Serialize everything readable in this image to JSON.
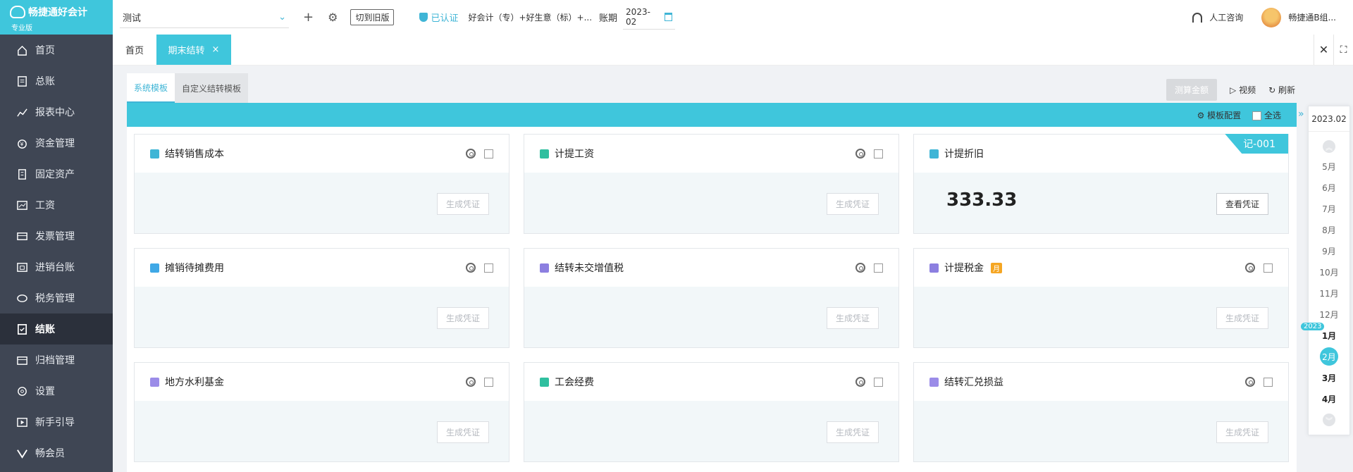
{
  "app": {
    "brand": "畅捷通好会计",
    "edition": "专业版"
  },
  "sidebar": {
    "items": [
      {
        "label": "首页",
        "icon": "home-icon"
      },
      {
        "label": "总账",
        "icon": "ledger-icon"
      },
      {
        "label": "报表中心",
        "icon": "chart-icon"
      },
      {
        "label": "资金管理",
        "icon": "money-bag-icon"
      },
      {
        "label": "固定资产",
        "icon": "building-icon"
      },
      {
        "label": "工资",
        "icon": "salary-icon"
      },
      {
        "label": "发票管理",
        "icon": "invoice-icon"
      },
      {
        "label": "进销台账",
        "icon": "inventory-icon"
      },
      {
        "label": "税务管理",
        "icon": "tax-icon"
      },
      {
        "label": "结账",
        "icon": "closing-icon",
        "active": true
      },
      {
        "label": "归档管理",
        "icon": "archive-icon"
      },
      {
        "label": "设置",
        "icon": "gear-icon"
      },
      {
        "label": "新手引导",
        "icon": "guide-icon"
      },
      {
        "label": "畅会员",
        "icon": "vip-icon"
      }
    ]
  },
  "topbar": {
    "account": "测试",
    "old_version": "切到旧版",
    "verified": "已认证",
    "company": "好会计（专）+好生意（标）+...",
    "period_label": "账期",
    "period_value": "2023-02",
    "support": "人工咨询",
    "user": "畅捷通B组..."
  },
  "tabs": {
    "home": "首页",
    "active": "期末结转"
  },
  "subtabs": {
    "system": "系统模板",
    "custom": "自定义结转模板"
  },
  "actions": {
    "calc": "测算金额",
    "video": "视频",
    "refresh": "刷新",
    "template_config": "模板配置",
    "select_all": "全选"
  },
  "cards": [
    {
      "title": "结转销售成本",
      "icon_color": "#3fb5d6",
      "button": "生成凭证"
    },
    {
      "title": "计提工资",
      "icon_color": "#2fbf9f",
      "button": "生成凭证"
    },
    {
      "title": "计提折旧",
      "icon_color": "#3fb5d6",
      "amount": "333.33",
      "button": "查看凭证",
      "voucher": "记-001"
    },
    {
      "title": "摊销待摊费用",
      "icon_color": "#3fa8e6",
      "button": "生成凭证"
    },
    {
      "title": "结转未交增值税",
      "icon_color": "#8c7fe0",
      "button": "生成凭证"
    },
    {
      "title": "计提税金",
      "icon_color": "#8c7fe0",
      "badge": "月",
      "button": "生成凭证"
    },
    {
      "title": "地方水利基金",
      "icon_color": "#9b8ce8",
      "button": "生成凭证"
    },
    {
      "title": "工会经费",
      "icon_color": "#2fbf9f",
      "button": "生成凭证"
    },
    {
      "title": "结转汇兑损益",
      "icon_color": "#9b8ce8",
      "button": "生成凭证"
    }
  ],
  "rail": {
    "current": "2023.02",
    "year_tag": "2023",
    "months": [
      "5月",
      "6月",
      "7月",
      "8月",
      "9月",
      "10月",
      "11月",
      "12月",
      "1月",
      "2月",
      "3月",
      "4月"
    ],
    "selected": "2月"
  },
  "colors": {
    "accent": "#3fc6dc",
    "sidebar": "#3f4654"
  }
}
